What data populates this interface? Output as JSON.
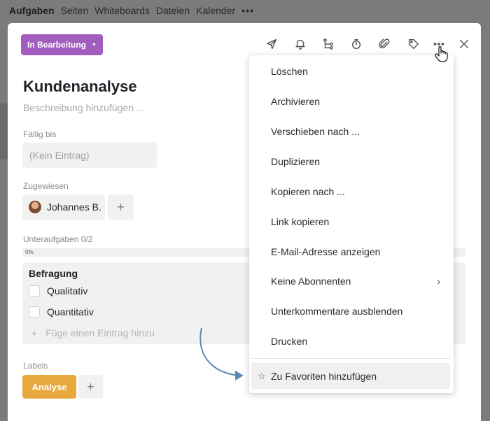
{
  "app_nav": {
    "tabs": [
      "Aufgaben",
      "Seiten",
      "Whiteboards",
      "Dateien",
      "Kalender"
    ],
    "more": "•••"
  },
  "task": {
    "status": "In Bearbeitung",
    "title": "Kundenanalyse",
    "description_placeholder": "Beschreibung hinzufügen ...",
    "due": {
      "label": "Fällig bis",
      "value": "(Kein Eintrag)"
    },
    "assigned": {
      "label": "Zugewiesen",
      "name": "Johannes B.",
      "add": "+"
    },
    "subtasks": {
      "label": "Unteraufgaben 0/2",
      "progress_text": "0%",
      "progress": 0
    },
    "checklist": {
      "title": "Befragung",
      "items": [
        "Qualitativ",
        "Quantitativ"
      ],
      "add_prefix": "+",
      "add_placeholder": "Füge einen Eintrag hinzu"
    },
    "labels": {
      "label": "Labels",
      "tags": [
        "Analyse"
      ],
      "add": "+",
      "tag_color": "#e7a83e"
    }
  },
  "toolbar": {
    "icons": [
      "send-icon",
      "bell-icon",
      "subtask-icon",
      "timer-icon",
      "paperclip-icon",
      "tag-icon",
      "more-icon",
      "close-icon"
    ]
  },
  "menu": {
    "items": [
      "Löschen",
      "Archivieren",
      "Verschieben nach ...",
      "Duplizieren",
      "Kopieren nach ...",
      "Link kopieren",
      "E-Mail-Adresse anzeigen",
      "Keine Abonnenten",
      "Unterkommentare ausblenden",
      "Drucken"
    ],
    "submenu_chevron": "›",
    "favorite": {
      "star": "☆",
      "label": "Zu Favoriten hinzufügen"
    }
  },
  "colors": {
    "status": "#a35dbf",
    "label": "#e7a83e",
    "arrow": "#5d86b8"
  }
}
